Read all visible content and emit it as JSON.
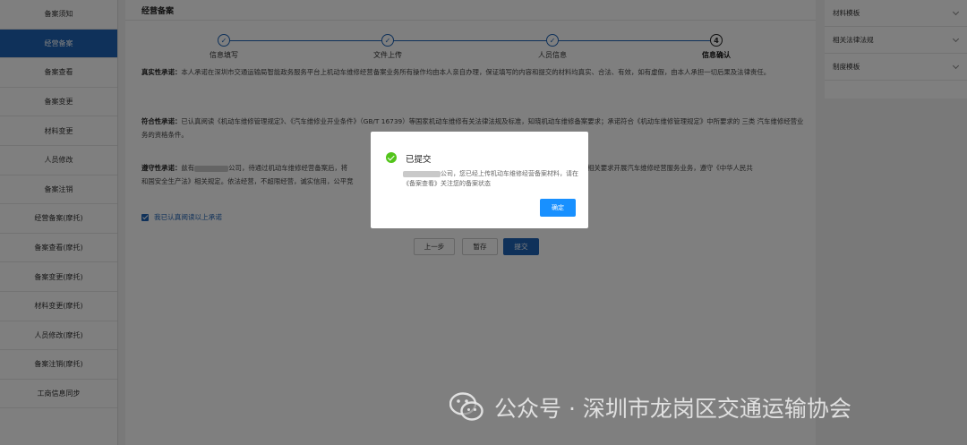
{
  "sidebar": {
    "items": [
      {
        "label": "备案须知",
        "active": false
      },
      {
        "label": "经营备案",
        "active": true
      },
      {
        "label": "备案查看",
        "active": false
      },
      {
        "label": "备案变更",
        "active": false
      },
      {
        "label": "材料变更",
        "active": false
      },
      {
        "label": "人员修改",
        "active": false
      },
      {
        "label": "备案注销",
        "active": false
      },
      {
        "label": "经营备案(摩托)",
        "active": false
      },
      {
        "label": "备案查看(摩托)",
        "active": false
      },
      {
        "label": "备案变更(摩托)",
        "active": false
      },
      {
        "label": "材料变更(摩托)",
        "active": false
      },
      {
        "label": "人员修改(摩托)",
        "active": false
      },
      {
        "label": "备案注销(摩托)",
        "active": false
      },
      {
        "label": "工商信息同步",
        "active": false
      }
    ]
  },
  "main": {
    "title": "经营备案",
    "steps": [
      {
        "number": "1",
        "label": "信息填写",
        "done": true
      },
      {
        "number": "2",
        "label": "文件上传",
        "done": true
      },
      {
        "number": "3",
        "label": "人员信息",
        "done": true
      },
      {
        "number": "4",
        "label": "信息确认",
        "done": false
      }
    ],
    "truth": {
      "heading": "真实性承诺：",
      "text": "本人承诺在深圳市交通运输局智能政务服务平台上机动车维修经营备案业务所有操作均由本人亲自办理，保证填写的内容和提交的材料均真实、合法、有效，如有虚假，由本人承担一切后果及法律责任。"
    },
    "compliance": {
      "heading": "符合性承诺：",
      "text": "已认真阅读《机动车维修管理规定》、《汽车维修业开业条件》（GB/T 16739）等国家机动车维修有关法律法规及标准，知晓机动车维修备案要求；承诺符合《机动车维修管理规定》中所要求的 三类 汽车维修经营业务的资格条件。"
    },
    "obey": {
      "heading": "遵守性承诺：",
      "text1": "兹有",
      "text2": "公司，待通过机动车维修经营备案后，将",
      "text3": "T 16739）相关要求开展汽车维修经营服务业务，遵守《中华人民共",
      "text4": "和国安全生产法》相关规定。依法经营，不超限经营，诚实信用，公平竞"
    },
    "agree_label": "我已认真阅读以上承诺",
    "buttons": {
      "prev": "上一步",
      "save": "暂存",
      "submit": "提交"
    }
  },
  "right_panel": {
    "items": [
      {
        "label": "材料模板"
      },
      {
        "label": "相关法律法规"
      },
      {
        "label": "制度模板"
      }
    ]
  },
  "dialog": {
    "title": "已提交",
    "message": "公司，您已经上传机动车维修经营备案材料，请在《备案查看》关注您的备案状态",
    "confirm": "确定"
  },
  "watermark": {
    "text": "公众号 · 深圳市龙岗区交通运输协会"
  },
  "colors": {
    "primary": "#1e62b4",
    "success": "#52c41a",
    "dialog_button": "#1890ff"
  }
}
